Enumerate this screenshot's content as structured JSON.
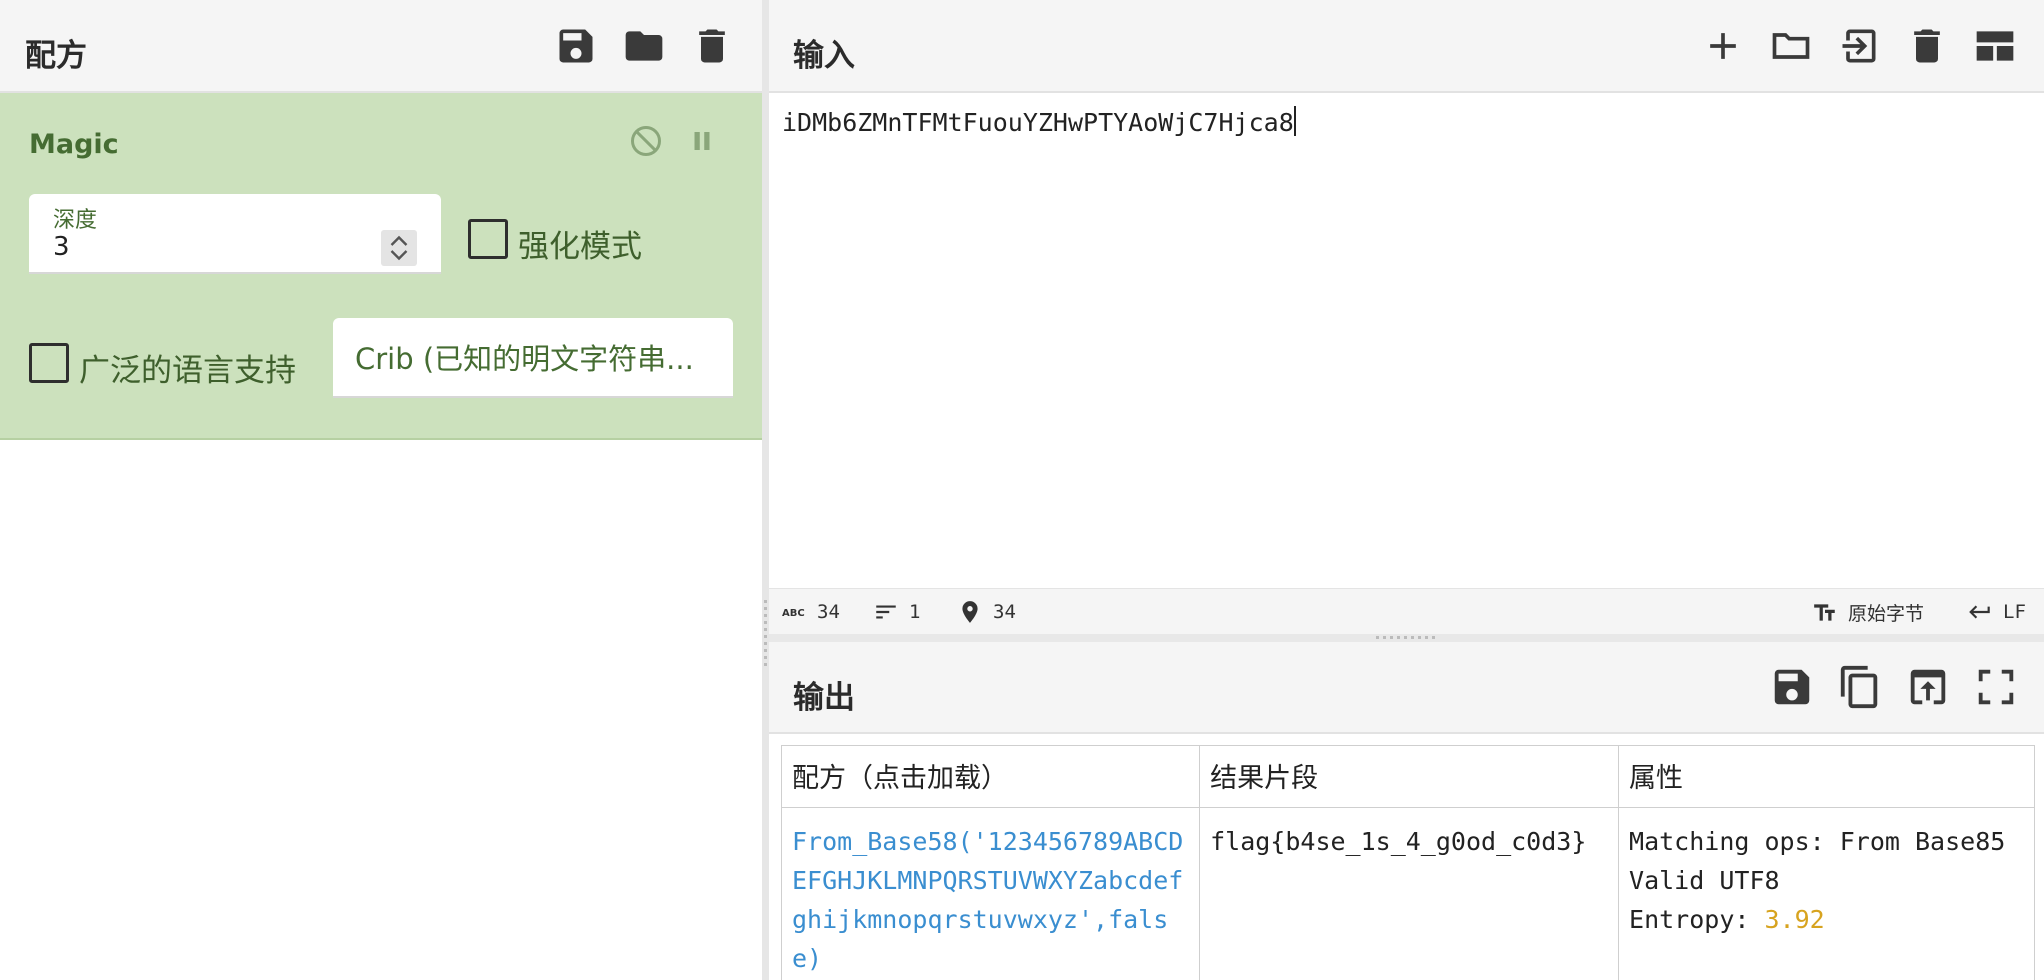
{
  "recipe": {
    "title": "配方",
    "icons": [
      "save-icon",
      "folder-icon",
      "trash-icon"
    ],
    "operation": {
      "name": "Magic",
      "depth_label": "深度",
      "depth_value": "3",
      "intensive_mode_label": "强化模式",
      "extensive_language_label": "广泛的语言支持",
      "crib_placeholder": "Crib (已知的明文字符串...",
      "controls": [
        "disable-icon",
        "pause-icon"
      ]
    }
  },
  "input": {
    "title": "输入",
    "text": "iDMb6ZMnTFMtFuouYZHwPTYAoWjC7Hjca8",
    "icons": [
      "plus-icon",
      "folder-icon",
      "import-icon",
      "trash-icon",
      "layout-icon"
    ],
    "status": {
      "length": "34",
      "lines": "1",
      "position": "34",
      "encoding": "原始字节",
      "eol": "LF"
    }
  },
  "output": {
    "title": "输出",
    "icons": [
      "save-icon",
      "copy-icon",
      "replace-input-icon",
      "maximize-icon"
    ],
    "table": {
      "headers": [
        "配方（点击加载）",
        "结果片段",
        "属性"
      ],
      "rows": [
        {
          "recipe": "From_Base58('123456789ABCDEFGHJKLMNPQRSTUVWXYZabcdefghijkmnopqrstuvwxyz',false)",
          "snippet": "flag{b4se_1s_4_g0od_c0d3}",
          "props_line1": "Matching ops: From Base85",
          "props_line2": "Valid UTF8",
          "entropy_label": "Entropy: ",
          "entropy_value": "3.92"
        }
      ]
    }
  },
  "colors": {
    "op_background": "#cce1bd",
    "op_text": "#456c32",
    "link": "#3a8ed0",
    "entropy": "#d7a31f"
  }
}
